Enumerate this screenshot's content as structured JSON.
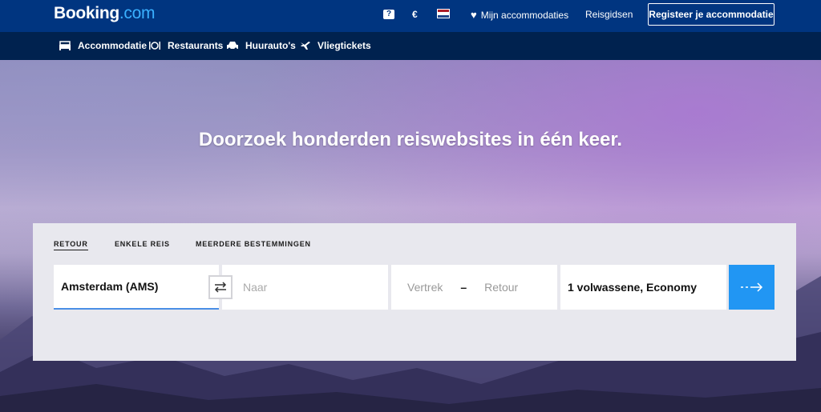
{
  "header": {
    "logo_main": "Booking",
    "logo_suffix": ".com",
    "help_icon": "question-icon",
    "currency": "€",
    "language_flag": "flag-nl-icon",
    "favorites_label": "Mijn accommodaties",
    "guides_label": "Reisgidsen",
    "register_label": "Registeer je accommodatie"
  },
  "nav": {
    "items": [
      {
        "label": "Accommodatie",
        "icon": "bed-icon"
      },
      {
        "label": "Restaurants",
        "icon": "restaurant-icon"
      },
      {
        "label": "Huurauto's",
        "icon": "car-icon"
      },
      {
        "label": "Vliegtickets",
        "icon": "plane-icon"
      }
    ]
  },
  "hero": {
    "headline": "Doorzoek honderden reiswebsites in één keer."
  },
  "search": {
    "tabs": [
      {
        "label": "RETOUR",
        "active": true
      },
      {
        "label": "ENKELE REIS",
        "active": false
      },
      {
        "label": "MEERDERE BESTEMMINGEN",
        "active": false
      }
    ],
    "origin_value": "Amsterdam (AMS)",
    "destination_placeholder": "Naar",
    "depart_placeholder": "Vertrek",
    "date_separator": "–",
    "return_placeholder": "Retour",
    "passengers_value": "1 volwassene, Economy",
    "search_icon": "arrow-right-icon"
  },
  "colors": {
    "brand": "#003580",
    "nav": "#00224f",
    "accent": "#2196f3",
    "logo_suffix": "#3ab0ff"
  }
}
